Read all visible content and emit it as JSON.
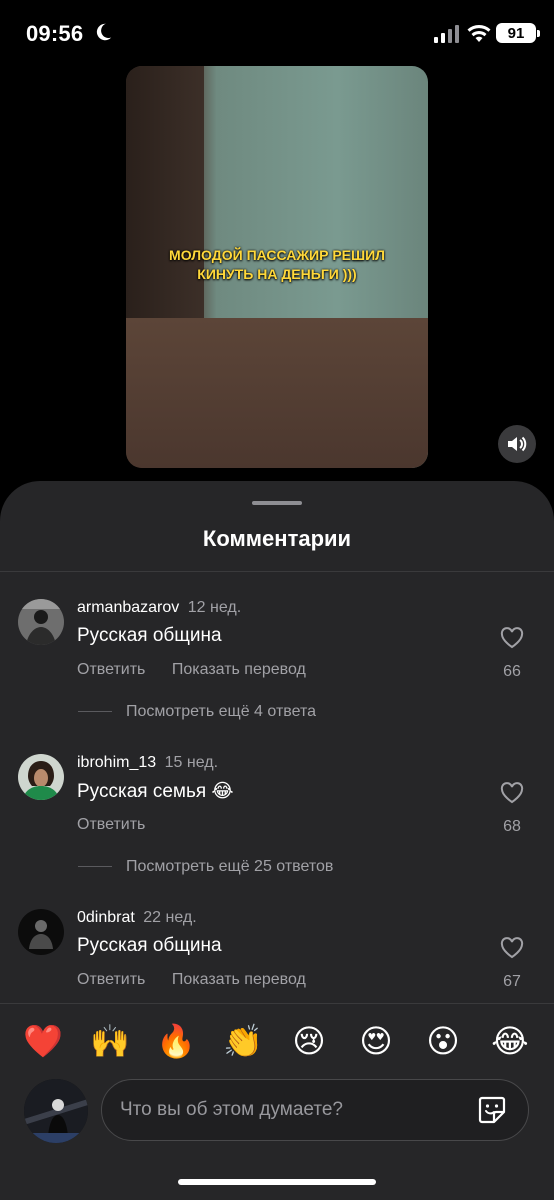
{
  "status_bar": {
    "time": "09:56",
    "battery": "91"
  },
  "video": {
    "caption_line1": "МОЛОДОЙ ПАССАЖИР РЕШИЛ",
    "caption_line2": "КИНУТЬ НА ДЕНЬГИ )))",
    "volume_icon": "speaker-icon"
  },
  "sheet": {
    "title": "Комментарии"
  },
  "comments": [
    {
      "user": "armanbazarov",
      "ago": "12 нед.",
      "text": "Русская община",
      "reply": "Ответить",
      "translate": "Показать перевод",
      "likes": "66",
      "more": "Посмотреть ещё 4 ответа"
    },
    {
      "user": "ibrohim_13",
      "ago": "15 нед.",
      "text": "Русская семья 😂",
      "reply": "Ответить",
      "likes": "68",
      "more": "Посмотреть ещё 25 ответов"
    },
    {
      "user": "0dinbrat",
      "ago": "22 нед.",
      "text": "Русская община",
      "reply": "Ответить",
      "translate": "Показать перевод",
      "likes": "67"
    }
  ],
  "reactions": [
    "❤️",
    "🙌",
    "🔥",
    "👏",
    "😢",
    "😍",
    "😮",
    "😂"
  ],
  "composer": {
    "placeholder": "Что вы об этом думаете?"
  },
  "colors": {
    "sheet_bg": "#262628",
    "caption": "#ffd83a",
    "muted": "#a1a1a6"
  }
}
